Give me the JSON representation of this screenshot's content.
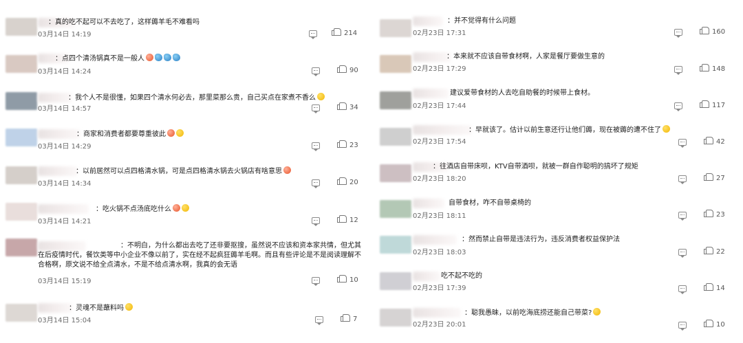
{
  "left_column": [
    {
      "text": "：真的吃不起可以不去吃了，这样薅羊毛不难看吗",
      "time": "03月14日 14:19",
      "likes": "214",
      "emoji": [],
      "avatar": "#d8d2cd"
    },
    {
      "text": "：点四个清汤锅真不是一般人",
      "time": "03月14日 14:24",
      "likes": "90",
      "emoji": [
        "red",
        "blue",
        "blue",
        "blue"
      ],
      "avatar": "#d9c9c2"
    },
    {
      "text": "：我个人不是很懂，如果四个清水何必去，那里菜那么贵，自己买点在家煮不香么",
      "time": "03月14日 14:57",
      "likes": "34",
      "emoji": [
        "yellow"
      ],
      "avatar": "#8f9ba6"
    },
    {
      "text": "：商家和消费者都要尊重彼此",
      "time": "03月14日 14:29",
      "likes": "23",
      "emoji": [
        "red",
        "yellow"
      ],
      "avatar": "#bfd2e8"
    },
    {
      "text": "：以前居然可以点四格清水锅，可是点四格清水锅去火锅店有啥意思",
      "time": "03月14日 14:34",
      "likes": "20",
      "emoji": [
        "red"
      ],
      "avatar": "#d5cfca"
    },
    {
      "text": "：吃火锅不点汤底吃什么",
      "time": "03月14日 14:21",
      "likes": "12",
      "emoji": [
        "red",
        "yellow"
      ],
      "avatar": "#e9dedc"
    },
    {
      "text": "：不明白，为什么都出去吃了还非要抠搜，虽然说不应该和资本家共情，但尤其在后疫情时代，餐饮类等中小企业不像以前了，实在经不起疯狂薅羊毛啊。而且有些评论是不是阅读理解不合格啊，原文说不给全点清水，不是不给点清水啊，我真的会无语",
      "time": "03月14日 15:19",
      "likes": "10",
      "emoji": [],
      "avatar": "#c7a7a9"
    },
    {
      "text": "：灵魂不是蘸料吗",
      "time": "03月14日 15:04",
      "likes": "7",
      "emoji": [
        "yellow"
      ],
      "avatar": "#ddd8d4"
    }
  ],
  "right_column": [
    {
      "text": "：并不觉得有什么问题",
      "time": "02月23日 17:31",
      "likes": "160",
      "emoji": [],
      "avatar": "#dcd6d3"
    },
    {
      "text": "：本来就不应该自带食材啊，人家是餐厅要做生意的",
      "time": "02月23日 17:29",
      "likes": "148",
      "emoji": [],
      "avatar": "#d9c8b8"
    },
    {
      "text": "建议爱带食材的人去吃自助餐的时候带上食材。",
      "time": "02月23日 17:44",
      "likes": "117",
      "emoji": [],
      "avatar": "#9fa09c"
    },
    {
      "text": "：早就该了。估计以前生意还行让他们薅，现在被薅的遭不住了",
      "time": "02月23日 17:54",
      "likes": "42",
      "emoji": [
        "yellow"
      ],
      "avatar": "#cfcfcf"
    },
    {
      "text": "：往酒店自带床呗，KTV自带酒呗，就被一群自作聪明的搞坏了规矩",
      "time": "02月23日 18:20",
      "likes": "27",
      "emoji": [],
      "avatar": "#cdbfc2"
    },
    {
      "text": "自带食材，咋不自带桌椅的",
      "time": "02月23日 18:11",
      "likes": "23",
      "emoji": [],
      "avatar": "#b3c8b5"
    },
    {
      "text": "：然而禁止自带是违法行为，违反消费者权益保护法",
      "time": "02月23日 18:03",
      "likes": "22",
      "emoji": [],
      "avatar": "#bfd9d9"
    },
    {
      "text": "吃不起不吃的",
      "time": "02月23日 17:39",
      "likes": "14",
      "emoji": [],
      "avatar": "#d0cfd4"
    },
    {
      "text": "：聪我愚昧，以前吃海底捞还能自己带菜?",
      "time": "02月23日 20:01",
      "likes": "10",
      "emoji": [
        "yellow"
      ],
      "avatar": "#d6d3d3"
    }
  ]
}
